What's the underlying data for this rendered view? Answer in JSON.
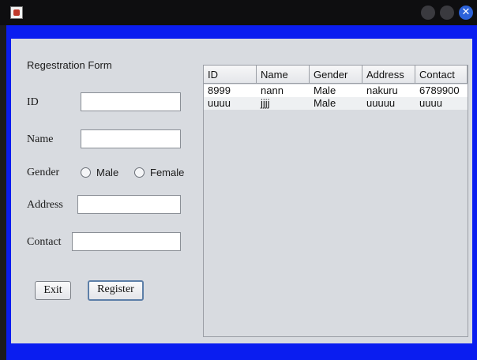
{
  "titlebar": {
    "title": ""
  },
  "form": {
    "title": "Regestration Form",
    "id_label": "ID",
    "name_label": "Name",
    "gender_label": "Gender",
    "male_label": "Male",
    "female_label": "Female",
    "address_label": "Address",
    "contact_label": "Contact",
    "id_value": "",
    "name_value": "",
    "address_value": "",
    "contact_value": "",
    "exit_label": "Exit",
    "register_label": "Register"
  },
  "table": {
    "columns": [
      "ID",
      "Name",
      "Gender",
      "Address",
      "Contact"
    ],
    "rows": [
      [
        "8999",
        "nann",
        "Male",
        "nakuru",
        "6789900"
      ],
      [
        "uuuu",
        "jjjj",
        "Male",
        "uuuuu",
        "uuuu"
      ]
    ]
  },
  "colors": {
    "frame_accent": "#0a1df0",
    "panel": "#d8dbe0",
    "close_button": "#2b62d9"
  }
}
